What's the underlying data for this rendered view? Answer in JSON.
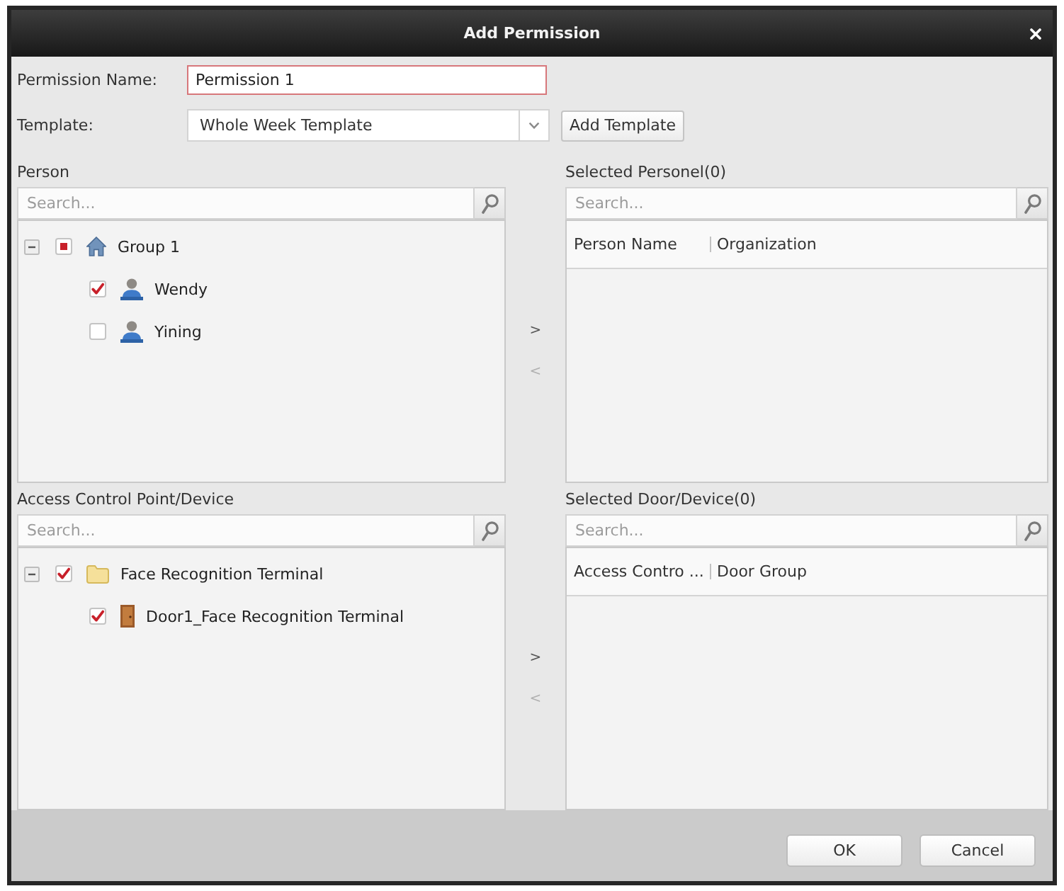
{
  "window": {
    "title": "Add Permission"
  },
  "permission_name": {
    "label": "Permission Name:",
    "value": "Permission 1",
    "focused": true
  },
  "template": {
    "label": "Template:",
    "value": "Whole Week Template",
    "button": "Add Template"
  },
  "person": {
    "label": "Person",
    "search": {
      "placeholder": "Search..."
    },
    "tree": [
      {
        "kind": "group",
        "label": "Group 1",
        "expanded": true,
        "checked": false,
        "partial": true,
        "children": [
          {
            "kind": "person",
            "label": "Wendy",
            "checked": true,
            "partial": false
          },
          {
            "kind": "person",
            "label": "Yining",
            "checked": false,
            "partial": false
          }
        ]
      }
    ]
  },
  "selected_personnel": {
    "label": "Selected Personel(0)",
    "search": {
      "placeholder": "Search..."
    },
    "columns": [
      "Person Name",
      "Organization"
    ]
  },
  "person_transfer": [
    {
      "label": ">",
      "disabled": false
    },
    {
      "label": "<",
      "disabled": true
    }
  ],
  "access_control": {
    "label": "Access Control Point/Device",
    "search": {
      "placeholder": "Search..."
    },
    "tree": [
      {
        "kind": "folder",
        "label": "Face Recognition Terminal",
        "expanded": true,
        "checked": true,
        "partial": false,
        "children": [
          {
            "kind": "door",
            "label": "Door1_Face Recognition Terminal",
            "checked": true,
            "partial": false
          }
        ]
      }
    ]
  },
  "selected_doors": {
    "label": "Selected Door/Device(0)",
    "search": {
      "placeholder": "Search..."
    },
    "columns": [
      "Access Contro ...",
      "Door Group"
    ]
  },
  "door_transfer": [
    {
      "label": ">",
      "disabled": false
    },
    {
      "label": "<",
      "disabled": true
    }
  ],
  "buttons": [
    "OK",
    "Cancel"
  ]
}
